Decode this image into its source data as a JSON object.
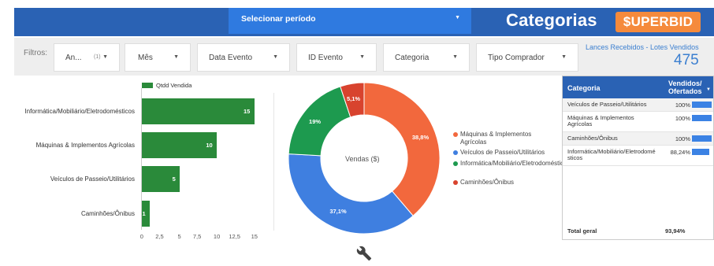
{
  "header": {
    "period_label": "Selecionar período",
    "title": "Categorias",
    "logo_text": "$UPERBID"
  },
  "filters": {
    "label": "Filtros:",
    "items": [
      {
        "label": "An...",
        "count": "(1)"
      },
      {
        "label": "Mês"
      },
      {
        "label": "Data Evento"
      },
      {
        "label": "ID Evento"
      },
      {
        "label": "Categoria"
      },
      {
        "label": "Tipo Comprador"
      }
    ]
  },
  "kpi": {
    "label": "Lances Recebidos - Lotes Vendidos",
    "value": "475"
  },
  "bar_chart": {
    "legend": "Qtdd Vendida",
    "ticks": [
      "0",
      "2,5",
      "5",
      "7,5",
      "10",
      "12,5",
      "15"
    ]
  },
  "donut": {
    "center_label": "Vendas ($)"
  },
  "chart_data": [
    {
      "type": "bar",
      "orientation": "horizontal",
      "categories": [
        "Informática/Mobiliário/Eletrodomésticos",
        "Máquinas & Implementos Agrícolas",
        "Veículos de Passeio/Utilitários",
        "Caminhões/Ônibus"
      ],
      "series": [
        {
          "name": "Qtdd Vendida",
          "values": [
            15,
            10,
            5,
            1
          ]
        }
      ],
      "xlim": [
        0,
        15
      ],
      "color": "#2a8a3a",
      "legend_position": "top"
    },
    {
      "type": "pie",
      "donut": true,
      "categories": [
        "Máquinas & Implementos Agrícolas",
        "Veículos de Passeio/Utilitários",
        "Informática/Mobiliário/Eletrodomésticos",
        "Caminhões/Ônibus"
      ],
      "values": [
        38.8,
        37.1,
        19,
        5.1
      ],
      "labels": [
        "38,8%",
        "37,1%",
        "19%",
        "5,1%"
      ],
      "colors": [
        "#f2683d",
        "#3f7fe0",
        "#1d9a4f",
        "#d8432e"
      ],
      "legend_position": "right"
    }
  ],
  "table": {
    "header_category": "Categoria",
    "header_value_line1": "Vendidos/",
    "header_value_line2": "Ofertados",
    "rows": [
      {
        "name": "Veículos de Passeio/Utilitários",
        "value": "100%",
        "pct": 1.0
      },
      {
        "name": "Máquinas & Implementos Agrícolas",
        "value": "100%",
        "pct": 1.0
      },
      {
        "name": "Caminhões/Ônibus",
        "value": "100%",
        "pct": 1.0
      },
      {
        "name": "Informática/Mobiliário/Eletrodomé sticos",
        "value": "88,24%",
        "pct": 0.8824
      }
    ],
    "total_label": "Total geral",
    "total_value": "93,94%"
  }
}
